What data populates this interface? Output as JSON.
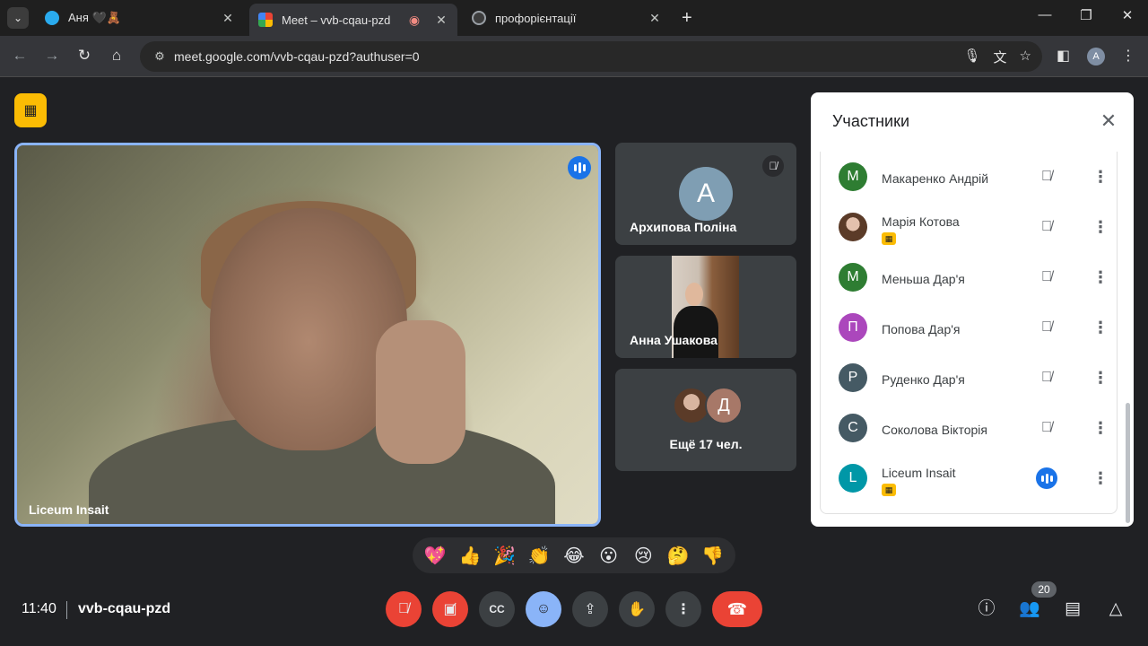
{
  "browser": {
    "tabs": [
      {
        "title": "Аня 🖤🧸",
        "favicon_color": "#2aabee",
        "active": false
      },
      {
        "title": "Meet – vvb-cqau-pzd",
        "favicon_color": "#00832d",
        "active": true
      },
      {
        "title": "профорієнтації",
        "favicon_color": "#9aa0a6",
        "active": false
      }
    ],
    "url": "meet.google.com/vvb-cqau-pzd?authuser=0",
    "profile_initial": "A"
  },
  "tiles": {
    "main": {
      "name": "Liceum Insait"
    },
    "side": [
      {
        "name": "Архипова Поліна",
        "initial": "А",
        "avatar_color": "#7f9eb3"
      },
      {
        "name": "Анна Ушакова"
      },
      {
        "label": "Ещё 17 чел.",
        "initial": "Д",
        "avatar_color": "#a77868"
      }
    ]
  },
  "panel": {
    "title": "Участники",
    "participants": [
      {
        "name": "Макаренко Андрій",
        "initial": "М",
        "color": "#2e7d32",
        "mic": "muted"
      },
      {
        "name": "Марія Котова",
        "initial": "",
        "color": "#6d4c41",
        "mic": "muted",
        "badge": true
      },
      {
        "name": "Меньша Дар'я",
        "initial": "М",
        "color": "#2e7d32",
        "mic": "muted"
      },
      {
        "name": "Попова Дар'я",
        "initial": "П",
        "color": "#ab47bc",
        "mic": "muted"
      },
      {
        "name": "Руденко Дар'я",
        "initial": "Р",
        "color": "#455a64",
        "mic": "muted"
      },
      {
        "name": "Соколова Вікторія",
        "initial": "С",
        "color": "#455a64",
        "mic": "muted"
      },
      {
        "name": "Liceum Insait",
        "initial": "L",
        "color": "#0097a7",
        "mic": "speaking",
        "badge": true
      }
    ]
  },
  "reactions": [
    "💖",
    "👍",
    "🎉",
    "👏",
    "😂",
    "😮",
    "😢",
    "🤔",
    "👎"
  ],
  "bottom": {
    "time": "11:40",
    "meeting_code": "vvb-cqau-pzd",
    "participant_count": "20"
  },
  "colors": {
    "accent": "#8ab4f8",
    "danger": "#ea4335",
    "speaking": "#1a73e8",
    "highlight": "#fbbc04"
  }
}
